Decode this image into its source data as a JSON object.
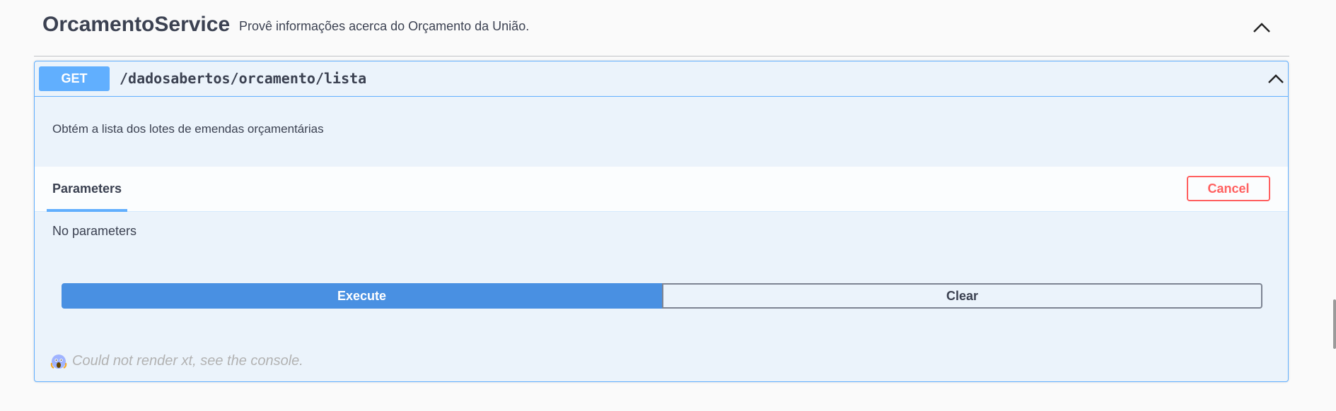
{
  "tag": {
    "title": "OrcamentoService",
    "description": "Provê informações acerca do Orçamento da União.",
    "toggle_icon": "chevron-up-icon"
  },
  "operation": {
    "method": "GET",
    "path": "/dadosabertos/orcamento/lista",
    "description": "Obtém a lista dos lotes de emendas orçamentárias",
    "toggle_icon": "chevron-up-icon"
  },
  "parameters": {
    "tab_label": "Parameters",
    "cancel_label": "Cancel",
    "empty_text": "No parameters"
  },
  "actions": {
    "execute_label": "Execute",
    "clear_label": "Clear"
  },
  "render_error": {
    "icon": "screaming-face-icon",
    "text": "Could not render xt, see the console."
  },
  "colors": {
    "get_method": "#61affe",
    "execute": "#4990e2",
    "cancel": "#ff6060",
    "block_background": "#ebf3fb",
    "text": "#3b4151"
  }
}
